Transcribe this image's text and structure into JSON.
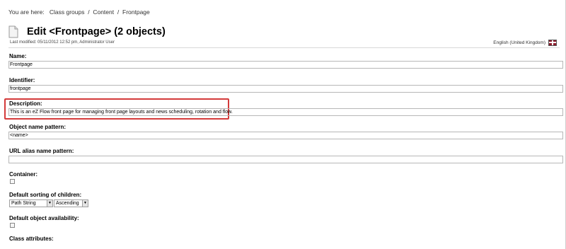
{
  "breadcrumb": {
    "prefix": "You are here:",
    "items": [
      "Class groups",
      "Content",
      "Frontpage"
    ],
    "separator": "/"
  },
  "header": {
    "title": "Edit <Frontpage> (2 objects)",
    "last_modified": "Last modified: 05/11/2012 12:52 pm, Administrator User",
    "language": "English (United Kingdom)"
  },
  "form": {
    "name": {
      "label": "Name:",
      "value": "Frontpage"
    },
    "identifier": {
      "label": "Identifier:",
      "value": "frontpage"
    },
    "description": {
      "label": "Description:",
      "value": "This is an eZ Flow front page for managing front page layouts and news scheduling, rotation and flow."
    },
    "object_name_pattern": {
      "label": "Object name pattern:",
      "value": "<name>"
    },
    "url_alias_pattern": {
      "label": "URL alias name pattern:",
      "value": ""
    },
    "container": {
      "label": "Container:",
      "checked": false
    },
    "default_sorting": {
      "label": "Default sorting of children:",
      "field": "Path String",
      "order": "Ascending"
    },
    "default_availability": {
      "label": "Default object availability:",
      "checked": false
    },
    "class_attributes": {
      "label": "Class attributes:"
    }
  },
  "colors": {
    "highlight_border": "#d43b3b"
  }
}
